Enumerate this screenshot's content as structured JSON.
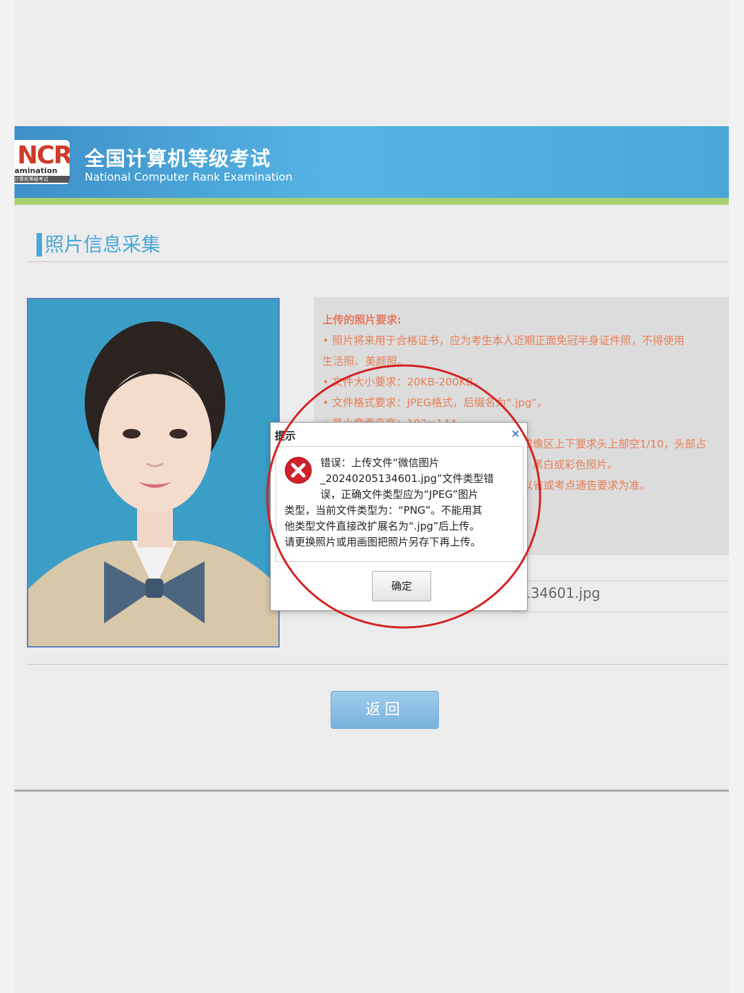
{
  "header": {
    "logo_mark": "NCR",
    "logo_word": "amination",
    "logo_sub": "计算机等级考试",
    "title": "全国计算机等级考试",
    "subtitle": "National Computer Rank Examination"
  },
  "section": {
    "title": "照片信息采集"
  },
  "requirements": {
    "title": "上传的照片要求:",
    "lines": [
      "• 照片将来用于合格证书，应为考生本人近期正面免冠半身证件照，不得使用",
      "生活照、美颜照。",
      "• 文件大小要求：20KB-200KB。",
      "• 文件格式要求：JPEG格式，后缀名为“.jpg”。",
      "• 最小像素高宽：192×144",
      "成像区上下要求头上部空1/10，头部占",
      "",
      "黑白或彩色照片。",
      "以省或考点通告要求为准。"
    ]
  },
  "file": {
    "name": "5134601.jpg"
  },
  "return_button": {
    "label": "返回"
  },
  "dialog": {
    "title": "提示",
    "close": "×",
    "message_lines": [
      "错误：上传文件“微信图片",
      "_20240205134601.jpg”文件类型错",
      "误，正确文件类型应为“JPEG”图片",
      "类型，当前文件类型为：“PNG”。不能用其",
      "他类型文件直接改扩展名为“.jpg”后上传。",
      "请更换照片或用画图把照片另存下再上传。"
    ],
    "ok_label": "确定"
  },
  "colors": {
    "header_blue": "#4aa7d8",
    "strip_green": "#a9cf6f",
    "requirement_text": "#e97e56",
    "annotation_red": "#d42020",
    "error_red": "#d0202a"
  }
}
